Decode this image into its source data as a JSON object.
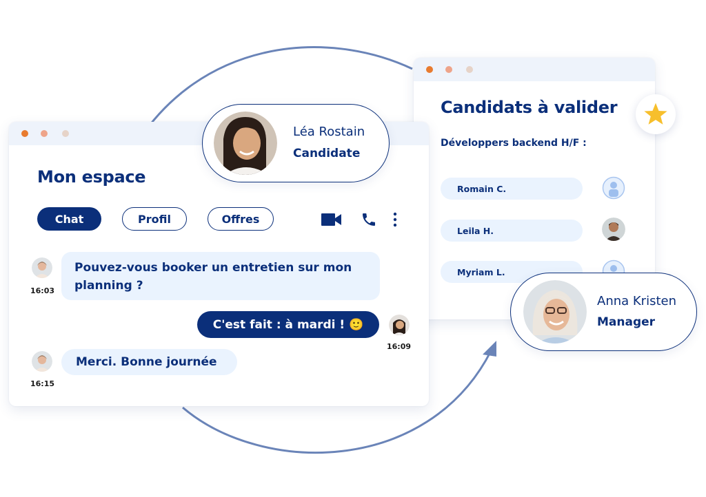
{
  "chat_window": {
    "title": "Mon espace",
    "tabs": [
      {
        "label": "Chat",
        "active": true
      },
      {
        "label": "Profil",
        "active": false
      },
      {
        "label": "Offres",
        "active": false
      }
    ],
    "actions": {
      "video": "video-call-icon",
      "phone": "phone-call-icon",
      "more": "more-options-icon"
    },
    "messages": [
      {
        "direction": "incoming",
        "text_line1": "Pouvez-vous booker un entretien sur mon",
        "text_line2": "planning ?",
        "time": "16:03"
      },
      {
        "direction": "outgoing",
        "text": "C'est fait : à mardi ! 🙂",
        "time": "16:09"
      },
      {
        "direction": "incoming",
        "text": "Merci. Bonne journée",
        "time": "16:15"
      }
    ]
  },
  "candidate_card": {
    "name": "Léa Rostain",
    "role": "Candidate"
  },
  "validation_window": {
    "title": "Candidats à valider",
    "subtitle": "Développers backend H/F :",
    "candidates": [
      {
        "name": "Romain C.",
        "avatar": "placeholder"
      },
      {
        "name": "Leila H.",
        "avatar": "photo"
      },
      {
        "name": "Myriam L.",
        "avatar": "placeholder"
      }
    ],
    "badge": "star-icon"
  },
  "manager_card": {
    "name": "Anna Kristen",
    "role": "Manager"
  },
  "colors": {
    "primary": "#0b2f7a",
    "bubble_light": "#eaf3fe",
    "titlebar": "#eef3fb",
    "arrow": "#6a84b8",
    "star": "#f7bf2c",
    "dot1": "#e87b2f",
    "dot2": "#eea48a",
    "dot3": "#e6d3c8"
  }
}
